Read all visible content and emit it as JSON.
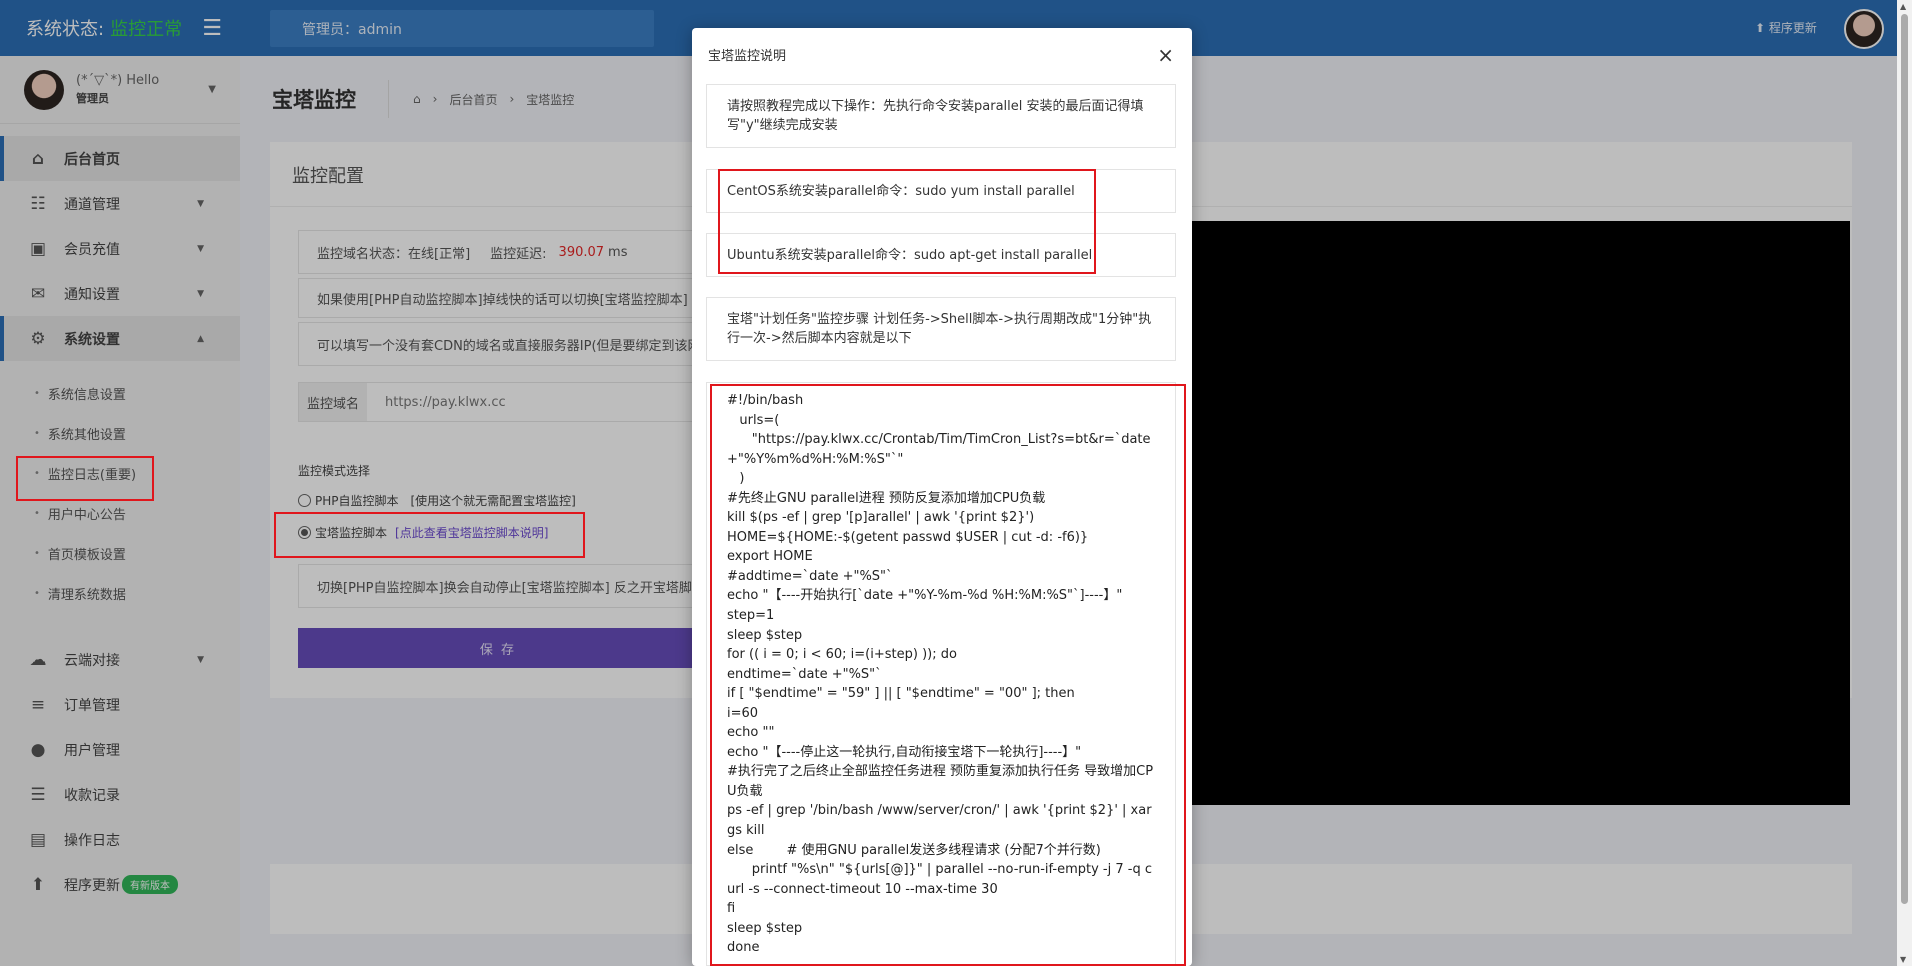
{
  "sidebar": {
    "brand_label": "系统状态:",
    "brand_status": "监控正常",
    "user_hello": "(*´▽`*) Hello",
    "user_role": "管理员",
    "items": [
      {
        "label": "后台首页"
      },
      {
        "label": "通道管理"
      },
      {
        "label": "会员充值"
      },
      {
        "label": "通知设置"
      },
      {
        "label": "系统设置"
      }
    ],
    "sub_items": [
      {
        "label": "系统信息设置"
      },
      {
        "label": "系统其他设置"
      },
      {
        "label": "监控日志(重要)"
      },
      {
        "label": "用户中心公告"
      },
      {
        "label": "首页模板设置"
      },
      {
        "label": "清理系统数据"
      }
    ],
    "bottom_items": [
      {
        "label": "云端对接"
      },
      {
        "label": "订单管理"
      },
      {
        "label": "用户管理"
      },
      {
        "label": "收款记录"
      },
      {
        "label": "操作日志"
      },
      {
        "label": "程序更新"
      }
    ],
    "new_badge": "有新版本"
  },
  "topbar": {
    "admin_label": "管理员：admin",
    "update_label": "程序更新"
  },
  "page": {
    "title": "宝塔监控",
    "breadcrumb": [
      "后台首页",
      "宝塔监控"
    ],
    "panel_title": "监控配置",
    "status_line": {
      "prefix": "监控域名状态：在线[正常]",
      "latency_label": "监控延迟:",
      "latency_value": "390.07",
      "latency_unit": "ms"
    },
    "tip_switch": "如果使用[PHP自动监控脚本]掉线快的话可以切换[宝塔监控脚本]",
    "tip_domain": "可以填写一个没有套CDN的域名或直接服务器IP(但是要绑定到该网站)",
    "domain_label": "监控域名",
    "domain_value": "https://pay.klwx.cc",
    "mode_title": "监控模式选择",
    "mode_php": "PHP自监控脚本",
    "mode_php_note": "[使用这个就无需配置宝塔监控]",
    "mode_bt": "宝塔监控脚本",
    "mode_bt_link": "[点此查看宝塔监控脚本说明]",
    "switch_note": "切换[PHP自监控脚本]换会自动停止[宝塔监控脚本] 反之开宝塔脚本",
    "save_label": "保 存"
  },
  "modal": {
    "title": "宝塔监控说明",
    "close": "×",
    "intro": "请按照教程完成以下操作：先执行命令安装parallel 安装的最后面记得填写\"y\"继续完成安装",
    "centos": "CentOS系统安装parallel命令：sudo yum install parallel",
    "ubuntu": "Ubuntu系统安装parallel命令：sudo apt-get install parallel",
    "task": "宝塔\"计划任务\"监控步骤 计划任务->Shell脚本->执行周期改成\"1分钟\"执行一次->然后脚本内容就是以下",
    "script": "#!/bin/bash\n   urls=(\n      \"https://pay.klwx.cc/Crontab/Tim/TimCron_List?s=bt&r=`date +\"%Y%m%d%H:%M:%S\"`\"\n   )\n#先终止GNU parallel进程 预防反复添加增加CPU负载\nkill $(ps -ef | grep '[p]arallel' | awk '{print $2}')\nHOME=${HOME:-$(getent passwd $USER | cut -d: -f6)}\nexport HOME\n#addtime=`date +\"%S\"`\necho \"【----开始执行[`date +\"%Y-%m-%d %H:%M:%S\"`]----】\"\nstep=1\nsleep $step\nfor (( i = 0; i < 60; i=(i+step) )); do\nendtime=`date +\"%S\"`\nif [ \"$endtime\" = \"59\" ] || [ \"$endtime\" = \"00\" ]; then\ni=60\necho \"\"\necho \"【----停止这一轮执行,自动衔接宝塔下一轮执行]----】\"\n#执行完了之后终止全部监控任务进程 预防重复添加执行任务 导致增加CPU负载\nps -ef | grep '/bin/bash /www/server/cron/' | awk '{print $2}' | xargs kill\nelse        # 使用GNU parallel发送多线程请求 (分配7个并行数)\n      printf \"%s\\n\" \"${urls[@]}\" | parallel --no-run-if-empty -j 7 -q curl -s --connect-timeout 10 --max-time 30\nfi\nsleep $step\ndone"
  }
}
